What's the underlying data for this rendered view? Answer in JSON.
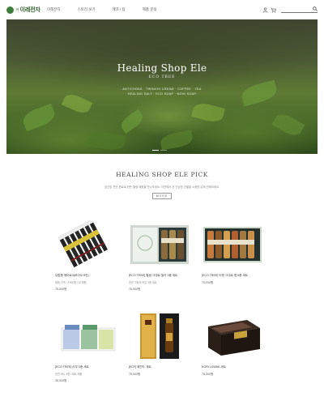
{
  "header": {
    "logo_small": "커",
    "logo_text": "이레전자",
    "nav": [
      "이레전자",
      "스토리 보기",
      "에코 / 팁",
      "제품 문의"
    ],
    "search_placeholder": ""
  },
  "hero": {
    "title": "Healing Shop Ele",
    "subtitle": "ECO TREE",
    "desc_line1": "ANTICHOKE · TWINCHI CREAM · COFFEE · TEA",
    "desc_line2": "HEALING SALT · ECO SOAP · NONI SOAP"
  },
  "section": {
    "title": "HEALING SHOP ELE PICK",
    "desc": "엄선된 천연 원료로 만든 힐링 제품을 만나보세요. 자연에서 온 건강한 선물을 소중한 분께 전해보세요.",
    "more_label": "MORE"
  },
  "products": [
    {
      "name": "유럽형 에어로3(바이오크린)",
      "desc": "체험 가격 / 2,900원 / 교 체험",
      "price": "75,000원"
    },
    {
      "name": "[ECO TREE] 힐링 그대로 밀키 3종 세트",
      "desc": "천연 가정의 조은 3종 세트",
      "price": "75,000원"
    },
    {
      "name": "[ECO TREE] 티엔 그대로 잼 6종 세트",
      "desc": "",
      "price": "75,000원"
    },
    {
      "name": "[ECO TREE] 리우 3종 세트",
      "desc": "천연 비누 3종 / 세트 제품",
      "price": "35,000원"
    },
    {
      "name": "[ECF] 해찬드 세트",
      "desc": "",
      "price": "75,000원"
    },
    {
      "name": "KORI LUWAK 세트",
      "desc": "",
      "price": "75,000원"
    }
  ],
  "colors": {
    "brand": "#2f5d2b",
    "text": "#333333"
  }
}
